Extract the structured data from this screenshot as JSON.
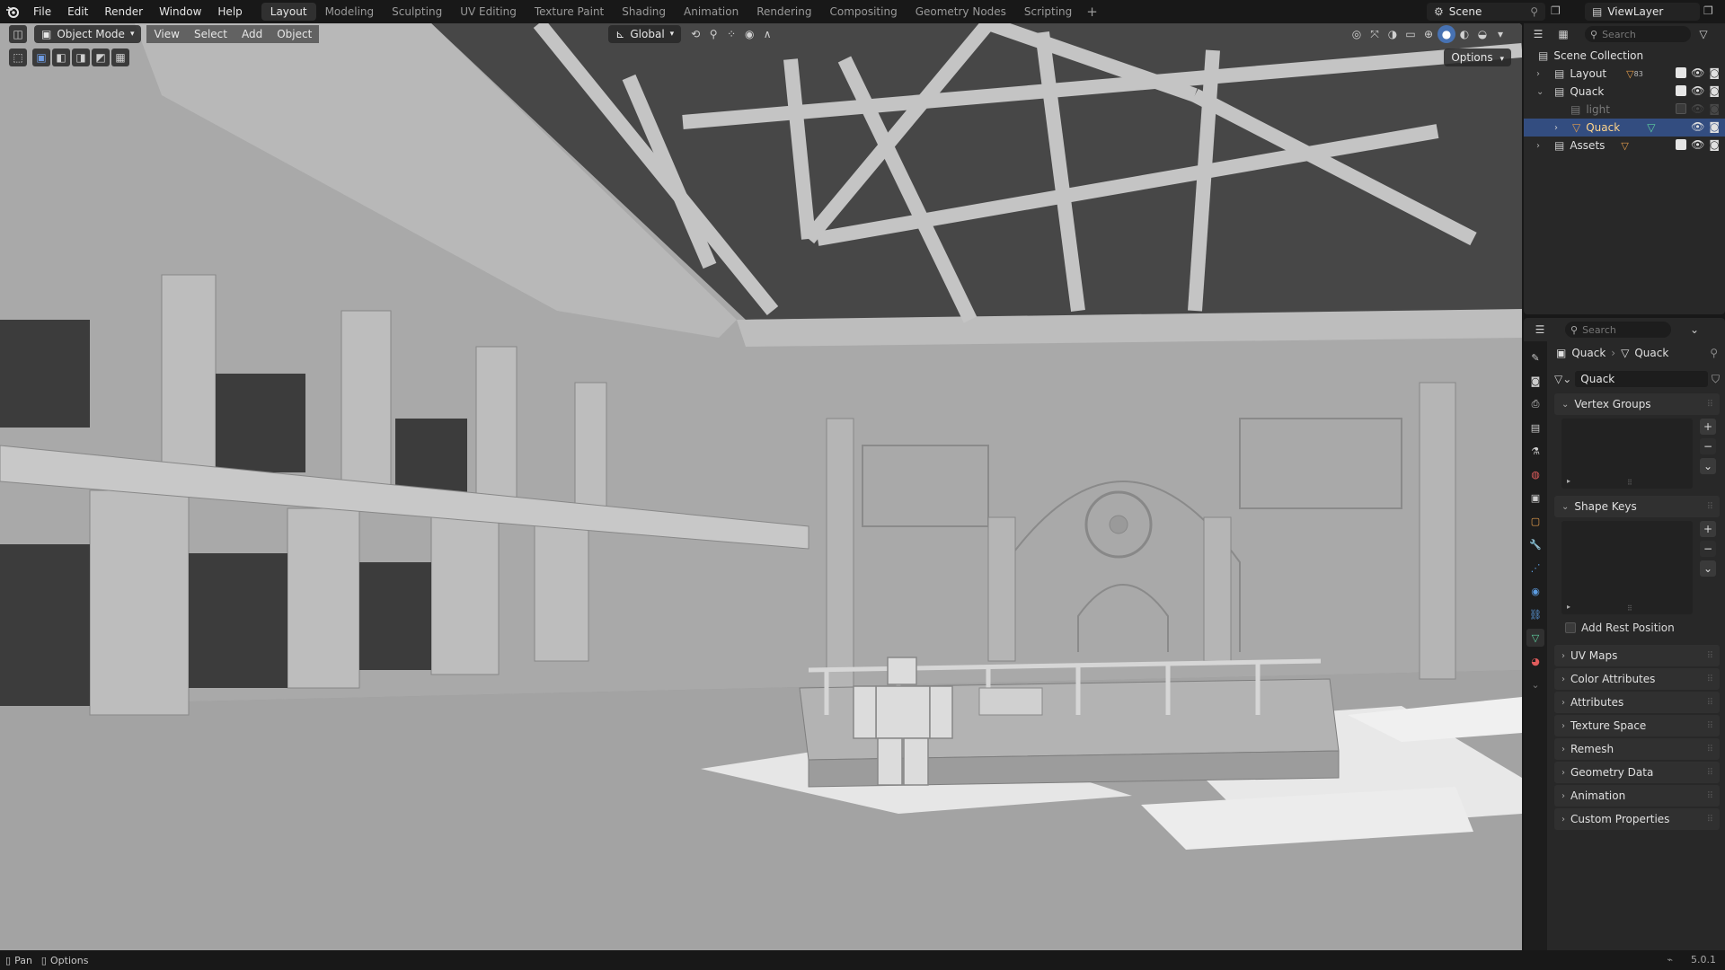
{
  "menu": [
    "File",
    "Edit",
    "Render",
    "Window",
    "Help"
  ],
  "workspaces": [
    "Layout",
    "Modeling",
    "Sculpting",
    "UV Editing",
    "Texture Paint",
    "Shading",
    "Animation",
    "Rendering",
    "Compositing",
    "Geometry Nodes",
    "Scripting"
  ],
  "active_workspace": "Layout",
  "scene_name": "Scene",
  "view_layer": "ViewLayer",
  "viewport": {
    "mode": "Object Mode",
    "menus": [
      "View",
      "Select",
      "Add",
      "Object"
    ],
    "transform_orientation": "Global",
    "options_label": "Options"
  },
  "outliner": {
    "search_placeholder": "Search",
    "root": "Scene Collection",
    "rows": [
      {
        "label": "Layout"
      },
      {
        "label": "Quack"
      },
      {
        "label": "light"
      },
      {
        "label": "Quack"
      },
      {
        "label": "Assets"
      }
    ],
    "badge_layout": "83"
  },
  "properties": {
    "search_placeholder": "Search",
    "breadcrumb_object": "Quack",
    "breadcrumb_data": "Quack",
    "mesh_name": "Quack",
    "panels": {
      "vertex_groups": "Vertex Groups",
      "shape_keys": "Shape Keys",
      "add_rest_position": "Add Rest Position",
      "uv_maps": "UV Maps",
      "color_attributes": "Color Attributes",
      "attributes": "Attributes",
      "texture_space": "Texture Space",
      "remesh": "Remesh",
      "geometry_data": "Geometry Data",
      "animation": "Animation",
      "custom_properties": "Custom Properties"
    }
  },
  "statusbar": {
    "pan": "Pan",
    "options": "Options",
    "version": "5.0.1"
  },
  "colors": {
    "accent_blue": "#4772b3",
    "selected_row": "#334d80",
    "header_bg": "#181818",
    "panel_bg": "#282828"
  }
}
